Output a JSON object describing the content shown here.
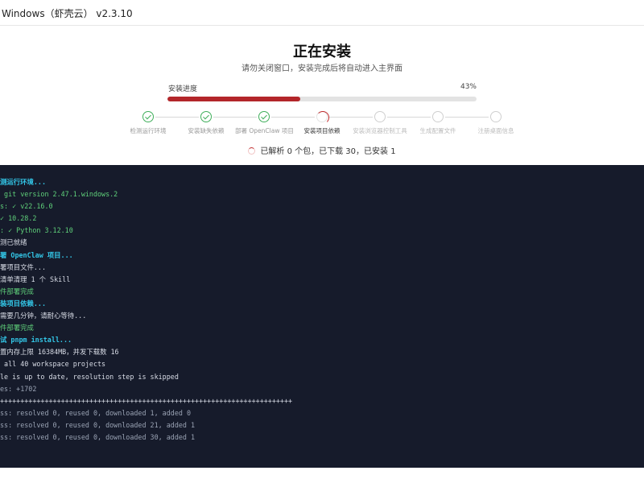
{
  "window": {
    "title": "Windows（虾壳云） v2.3.10"
  },
  "header": {
    "title": "正在安装",
    "subtitle": "请勿关闭窗口，安装完成后将自动进入主界面"
  },
  "progress": {
    "label": "安装进度",
    "percent_text": "43%",
    "value": 0.43,
    "fill_color": "#b3262a"
  },
  "steps": [
    {
      "label": "检测运行环境",
      "state": "done"
    },
    {
      "label": "安装缺失依赖",
      "state": "done"
    },
    {
      "label": "部署 OpenClaw 项目",
      "state": "done"
    },
    {
      "label": "安装项目依赖",
      "state": "active"
    },
    {
      "label": "安装浏览器控制工具",
      "state": "pending"
    },
    {
      "label": "生成配置文件",
      "state": "pending"
    },
    {
      "label": "注册桌面信息",
      "state": "pending"
    }
  ],
  "status": {
    "text": "已解析 0 个包，已下载 30，已安装 1"
  },
  "terminal": {
    "lines": [
      {
        "text": "测运行环境...",
        "style": "heading-c"
      },
      {
        "text": " git version 2.47.1.windows.2",
        "style": "ok"
      },
      {
        "text": "s: ✓ v22.16.0",
        "style": "ok"
      },
      {
        "text": "✓ 10.28.2",
        "style": "ok"
      },
      {
        "text": ": ✓ Python 3.12.10",
        "style": "ok"
      },
      {
        "text": "测已就绪",
        "style": "plain"
      },
      {
        "text": "署 OpenClaw 项目...",
        "style": "heading-c"
      },
      {
        "text": "署项目文件...",
        "style": "plain"
      },
      {
        "text": "清单清理 1 个 Skill",
        "style": "plain"
      },
      {
        "text": "件部署完成",
        "style": "ok"
      },
      {
        "text": "装项目依赖...",
        "style": "heading-c"
      },
      {
        "text": "需要几分钟，请耐心等待...",
        "style": "plain"
      },
      {
        "text": "件部署完成",
        "style": "ok"
      },
      {
        "text": "试 pnpm install...",
        "style": "heading-c"
      },
      {
        "text": "置内存上限 16384MB，并发下载数 16",
        "style": "plain"
      },
      {
        "text": " all 40 workspace projects",
        "style": "plain"
      },
      {
        "text": "le is up to date, resolution step is skipped",
        "style": "plain"
      },
      {
        "text": "es: +1702",
        "style": "muted"
      },
      {
        "text": "++++++++++++++++++++++++++++++++++++++++++++++++++++++++++++++++++++++++",
        "style": "plain"
      },
      {
        "text": "ss: resolved 0, reused 0, downloaded 1, added 0",
        "style": "muted"
      },
      {
        "text": "ss: resolved 0, reused 0, downloaded 21, added 1",
        "style": "muted"
      },
      {
        "text": "ss: resolved 0, reused 0, downloaded 30, added 1",
        "style": "muted"
      }
    ]
  },
  "colors": {
    "done": "#3fae5a",
    "active": "#c0292b",
    "terminal_bg": "#161b2b",
    "terminal_heading": "#33c7e8",
    "terminal_ok": "#5fd07a"
  }
}
